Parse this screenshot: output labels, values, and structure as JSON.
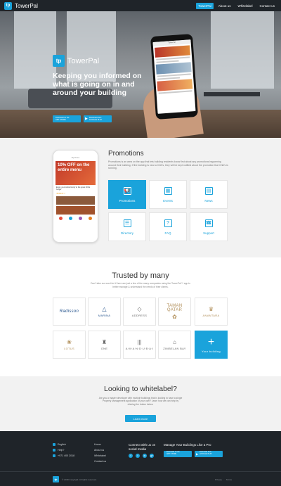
{
  "nav": {
    "logo_mark": "tp",
    "brand": "TowerPal",
    "links": [
      "TowerPal",
      "About us",
      "Whitelabel",
      "Contact us"
    ]
  },
  "hero": {
    "logo_mark": "tp",
    "brand": "TowerPal",
    "title": "Keeping you informed on what is going on in and around your building",
    "app_store": {
      "small": "Download on the",
      "big": "APP STORE"
    },
    "google_play": {
      "small": "Download from",
      "big": "GOOGLE PLAY"
    },
    "phone_header": "TowerPal"
  },
  "promotions": {
    "title": "Promotions",
    "description": "Promotions is an area on the app that lets building residents know first about any promotions happening around their building. If the building is near a Chili's, they will be kept notified about the promotion that Chili's is running.",
    "mock": {
      "header": "My Promo",
      "banner": "10% OFF on the entire menu",
      "item": "Enjoy your whole family to the great Chilis burger",
      "stars": "★★★★☆"
    },
    "tiles": [
      {
        "label": "Promotions",
        "icon": "megaphone-icon",
        "glyph": "📢"
      },
      {
        "label": "Events",
        "icon": "calendar-icon",
        "glyph": "▦"
      },
      {
        "label": "News",
        "icon": "news-icon",
        "glyph": "▤"
      },
      {
        "label": "Directory",
        "icon": "directory-icon",
        "glyph": "☰"
      },
      {
        "label": "FAQ",
        "icon": "faq-icon",
        "glyph": "?"
      },
      {
        "label": "Support",
        "icon": "support-icon",
        "glyph": "☎"
      }
    ]
  },
  "trusted": {
    "title": "Trusted by many",
    "description": "Don't take our word for it! here are just a few of the many companies using the TowerPal™ app to better manage & understand the needs of their clients.",
    "logos": [
      {
        "name": "Radisson Blu",
        "mark": "Radisson",
        "glyph": ""
      },
      {
        "name": "Marina",
        "mark": "MARINA",
        "glyph": "△"
      },
      {
        "name": "The Address",
        "mark": "ADDRESS",
        "glyph": "◇"
      },
      {
        "name": "Taman Qatar",
        "mark": "TAMAN QATAR",
        "glyph": "✿"
      },
      {
        "name": "Anantara",
        "mark": "ANANTARA",
        "glyph": "♛"
      },
      {
        "name": "Lotus",
        "mark": "LOTUS",
        "glyph": "❀"
      },
      {
        "name": "One",
        "mark": "ONE",
        "glyph": "♜"
      },
      {
        "name": "Hotel",
        "mark": "A·M·A·N·D·U·B·A·I",
        "glyph": "|||"
      },
      {
        "name": "Zimbelan Bay",
        "mark": "ZIMBELAN BAY",
        "glyph": "⌂"
      }
    ],
    "add": {
      "label": "Your building",
      "plus": "+"
    }
  },
  "whitelabel": {
    "title": "Looking to whitelabel?",
    "description": "Are you a master developer with multiple buildings that is looking to have a single Property Management application of your own? Learn how we can help by clicking the button below.",
    "button": "Learn more"
  },
  "footer": {
    "lang": [
      "English",
      "Help?",
      "+971 400 2018"
    ],
    "links": [
      "Home",
      "About us",
      "Whitelabel",
      "Contact us"
    ],
    "social_title": "Connect with us on social media",
    "social": [
      "f",
      "t",
      "in",
      "g+"
    ],
    "manage_title": "Manage Your Buildings Like a Pro",
    "app_store": {
      "small": "Download on the",
      "big": "APP STORE"
    },
    "google_play": {
      "small": "Download from",
      "big": "GOOGLE PLAY"
    },
    "logo_mark": "tp",
    "copyright": "© 2018 Copyright. All rights reserved.",
    "legal": [
      "Privacy",
      "Terms"
    ]
  }
}
